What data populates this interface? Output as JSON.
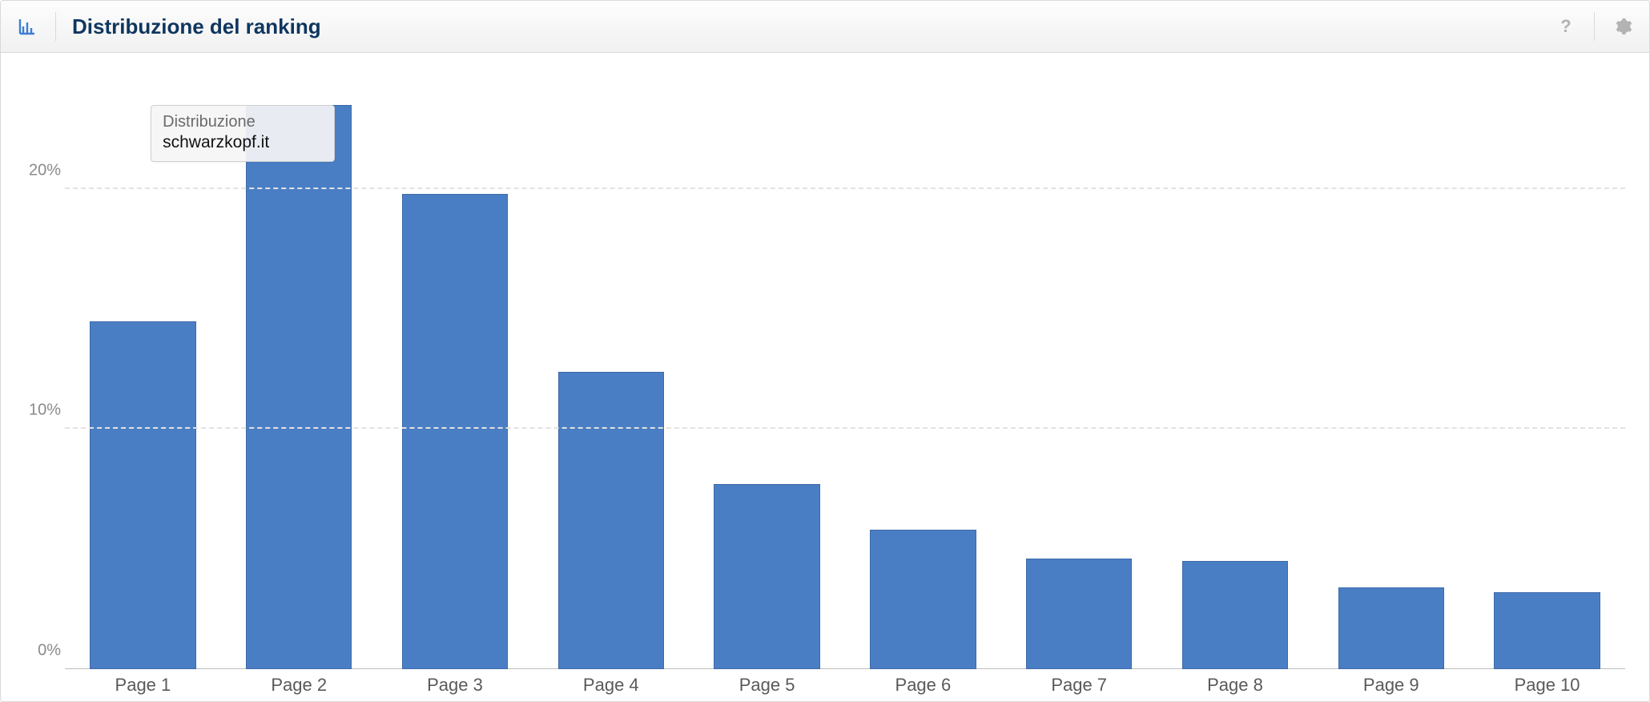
{
  "header": {
    "title": "Distribuzione del ranking"
  },
  "tooltip": {
    "title": "Distribuzione",
    "value": "schwarzkopf.it"
  },
  "chart_data": {
    "type": "bar",
    "title": "Distribuzione del ranking",
    "xlabel": "",
    "ylabel": "",
    "ylim": [
      0,
      25
    ],
    "y_ticks": [
      0,
      10,
      20
    ],
    "y_tick_labels": [
      "0%",
      "10%",
      "20%"
    ],
    "categories": [
      "Page 1",
      "Page 2",
      "Page 3",
      "Page 4",
      "Page 5",
      "Page 6",
      "Page 7",
      "Page 8",
      "Page 9",
      "Page 10"
    ],
    "values": [
      14.5,
      23.5,
      19.8,
      12.4,
      7.7,
      5.8,
      4.6,
      4.5,
      3.4,
      3.2
    ]
  }
}
